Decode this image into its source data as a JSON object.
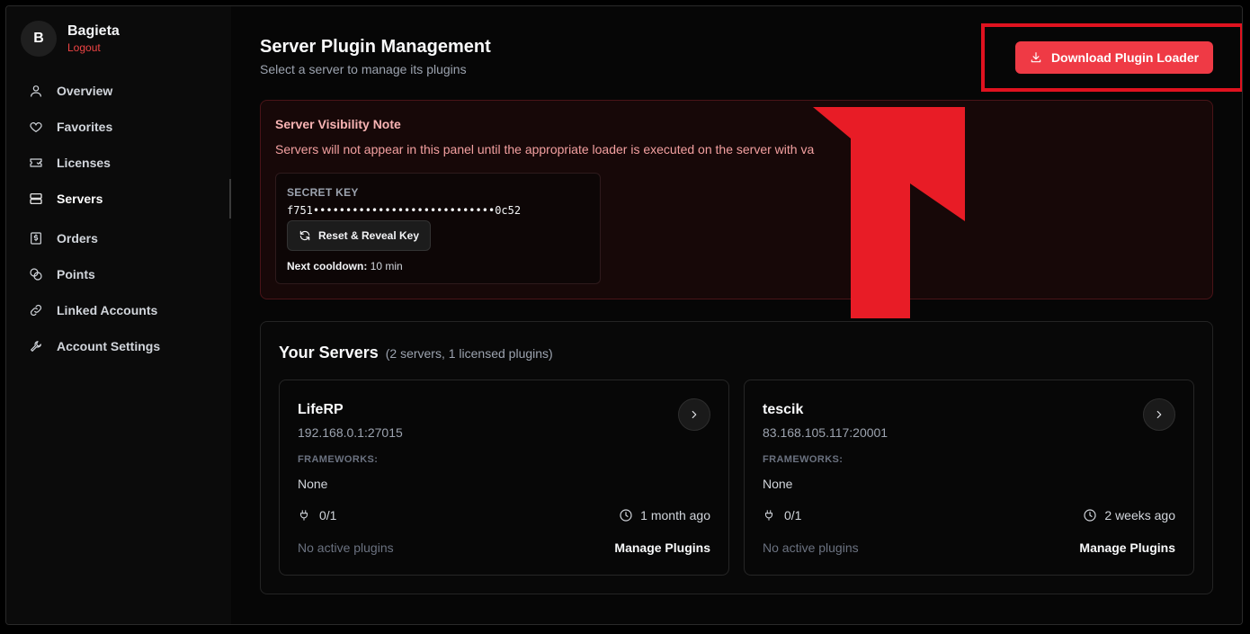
{
  "user": {
    "initial": "B",
    "name": "Bagieta",
    "logout_label": "Logout"
  },
  "sidebar": {
    "items": [
      {
        "label": "Overview",
        "icon": "user-icon"
      },
      {
        "label": "Favorites",
        "icon": "heart-icon"
      },
      {
        "label": "Licenses",
        "icon": "ticket-icon"
      },
      {
        "label": "Servers",
        "icon": "server-icon",
        "active": true
      },
      {
        "label": "Orders",
        "icon": "receipt-icon"
      },
      {
        "label": "Points",
        "icon": "coins-icon"
      },
      {
        "label": "Linked Accounts",
        "icon": "link-icon"
      },
      {
        "label": "Account Settings",
        "icon": "wrench-icon"
      }
    ]
  },
  "header": {
    "title": "Server Plugin Management",
    "subtitle": "Select a server to manage its plugins",
    "download_label": "Download Plugin Loader"
  },
  "note": {
    "title": "Server Visibility Note",
    "text": "Servers will not appear in this panel until the appropriate loader is executed on the server with va",
    "key_label": "SECRET KEY",
    "key_value": "f751••••••••••••••••••••••••••••0c52",
    "reset_label": "Reset & Reveal Key",
    "cooldown_label": "Next cooldown:",
    "cooldown_value": "10 min"
  },
  "servers": {
    "title": "Your Servers",
    "count": "(2 servers, 1 licensed plugins)",
    "frameworks_label": "FRAMEWORKS:",
    "manage_label": "Manage Plugins",
    "no_active_label": "No active plugins",
    "list": [
      {
        "name": "LifeRP",
        "ip": "192.168.0.1:27015",
        "frameworks": "None",
        "plugins": "0/1",
        "time": "1 month ago"
      },
      {
        "name": "tescik",
        "ip": "83.168.105.117:20001",
        "frameworks": "None",
        "plugins": "0/1",
        "time": "2 weeks ago"
      }
    ]
  },
  "colors": {
    "accent": "#ef3a45",
    "annotation": "#e0121f"
  }
}
